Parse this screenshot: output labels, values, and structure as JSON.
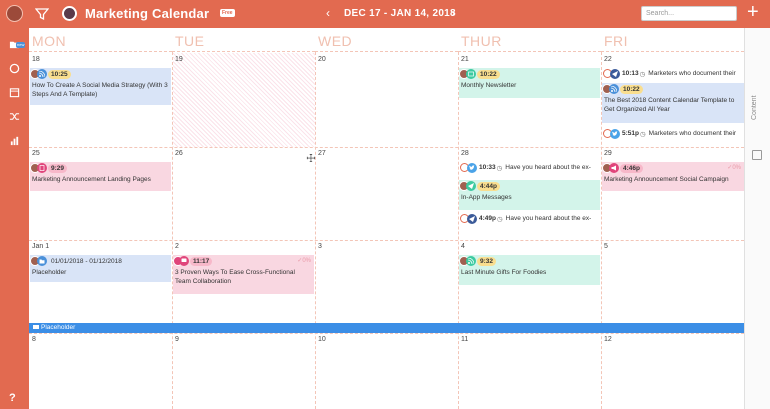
{
  "app": {
    "title": "Marketing Calendar",
    "badge": "Free",
    "date_range": "DEC 17 - JAN 14, 2018",
    "search_placeholder": "Search...",
    "prev_arrow": "‹",
    "next_arrow": "›",
    "add": "+",
    "right_panel_label": "Content",
    "help": "?",
    "sidebar_new_badge": "new"
  },
  "colors": {
    "accent": "#e26a50",
    "event_blue": "#d9e4f7",
    "event_teal": "#d3f4ea",
    "event_pink": "#f9d7e1",
    "banner": "#3b8ee6"
  },
  "days": [
    "MON",
    "TUE",
    "WED",
    "THUR",
    "FRI"
  ],
  "weeks": [
    [
      "18",
      "19",
      "20",
      "21",
      "22"
    ],
    [
      "25",
      "26",
      "27",
      "28",
      "29"
    ],
    [
      "Jan 1",
      "2",
      "3",
      "4",
      "5"
    ],
    [
      "8",
      "9",
      "10",
      "11",
      "12"
    ]
  ],
  "events": {
    "w1_mon": {
      "time": "10:25",
      "text": "How To Create A Social Media Strategy (With 3 Steps And A Template)",
      "icon": "rss-icon"
    },
    "w1_thu": {
      "time": "10:22",
      "text": "Monthly Newsletter",
      "icon": "email-icon"
    },
    "w1_fri_a": {
      "time": "10:13",
      "text": "Marketers who document their",
      "icon": "send-icon"
    },
    "w1_fri_b": {
      "time": "10:22",
      "text": "The Best 2018 Content Calendar Template to Get Organized All Year",
      "icon": "rss-icon"
    },
    "w1_fri_c": {
      "time": "5:51p",
      "text": "Marketers who document their",
      "icon": "twitter-icon"
    },
    "w2_mon": {
      "time": "9:29",
      "text": "Marketing Announcement Landing Pages",
      "icon": "page-icon"
    },
    "w2_thu_a": {
      "time": "10:33",
      "text": "Have you heard about the ex-",
      "icon": "twitter-icon"
    },
    "w2_thu_b": {
      "time": "4:44p",
      "text": "In-App Messages",
      "icon": "send-icon"
    },
    "w2_thu_c": {
      "time": "4:49p",
      "text": "Have you heard about the ex-",
      "icon": "send-icon"
    },
    "w2_fri": {
      "time": "4:46p",
      "text": "Marketing Announcement Social Campaign",
      "icon": "megaphone-icon",
      "progress": "0%"
    },
    "w3_mon": {
      "time": "01/01/2018 - 01/12/2018",
      "text": "Placeholder",
      "icon": "folder-icon"
    },
    "w3_tue": {
      "time": "11:17",
      "text": "3 Proven Ways To Ease Cross-Functional Team Collaboration",
      "icon": "chat-icon",
      "progress": "0%"
    },
    "w3_thu": {
      "time": "9:32",
      "text": "Last Minute Gifts For Foodies",
      "icon": "rss-icon"
    }
  },
  "banner": {
    "text": "Placeholder"
  }
}
